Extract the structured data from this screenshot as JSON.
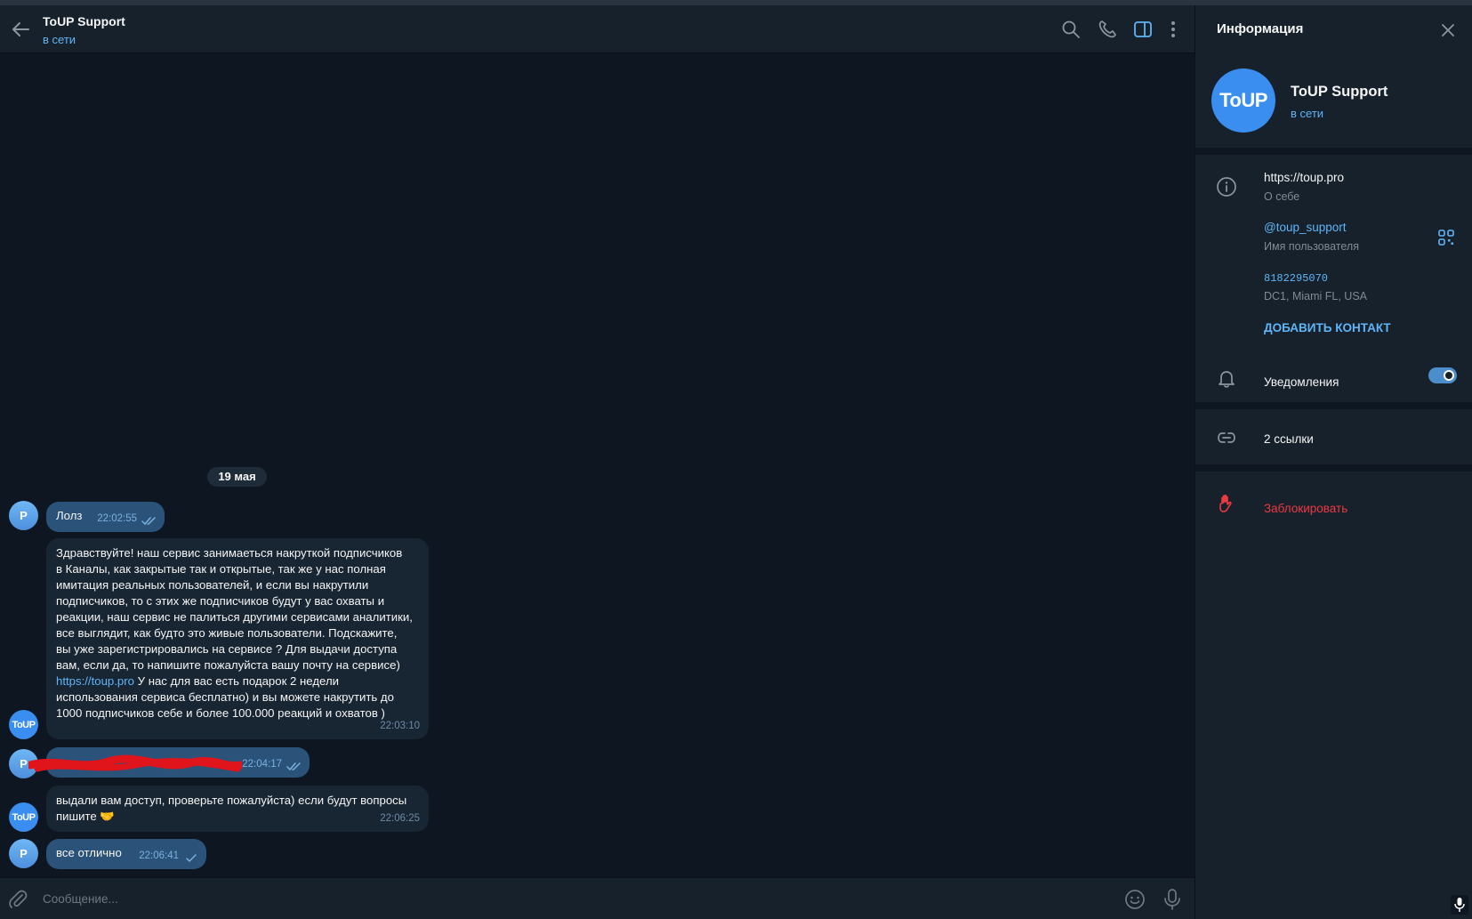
{
  "header": {
    "title": "ToUP Support",
    "status": "в сети"
  },
  "chat": {
    "date": "19 мая",
    "messages": [
      {
        "from": "P",
        "text": "Лолз",
        "time": "22:02:55"
      },
      {
        "from": "ToUP",
        "text_lines": [
          "Здравствуйте! наш сервис занимаеться накруткой подписчиков",
          "в Каналы, как закрытые так и открытые, так же у нас полная",
          "имитация реальных пользователей, и если вы накрутили",
          "подписчиков, то с этих же подписчиков будут у вас охваты и",
          "реакции, наш сервис не палиться другими сервисами аналитики,",
          "все выглядит, как будто это живые пользователи. Подскажите,",
          "вы уже зарегистрировались на сервисе ? Для выдачи доступа",
          "вам, если да, то напишите пожалуйста вашу почту на сервисе)"
        ],
        "link": "https://toup.pro",
        "text_after_link": " У нас для вас есть подарок 2 недели",
        "text_lines_end": [
          "использования сервиса бесплатно) и вы можете накрутить до",
          "1000 подписчиков себе и более 100.000 реакций и охватов )"
        ],
        "time": "22:03:10"
      },
      {
        "from": "P",
        "text": "",
        "time": "22:04:17"
      },
      {
        "from": "ToUP",
        "text_line1": "выдали вам доступ, проверьте пожалуйста) если будут вопросы",
        "text_line2": "пишите 🤝",
        "time": "22:06:25"
      },
      {
        "from": "P",
        "text": "все отлично",
        "time": "22:06:41"
      }
    ],
    "avatar_p": "P",
    "avatar_toup": "ToUP"
  },
  "composer": {
    "placeholder": "Сообщение..."
  },
  "info": {
    "title": "Информация",
    "name": "ToUP Support",
    "status": "в сети",
    "avatar_text": "ToUP",
    "bio": "https://toup.pro",
    "bio_label": "О себе",
    "username": "@toup_support",
    "username_label": "Имя пользователя",
    "user_id": "8182295070",
    "dc": "DC1, Miami FL, USA",
    "add_contact": "ДОБАВИТЬ КОНТАКТ",
    "notifications": "Уведомления",
    "notifications_on": true,
    "links": "2 ссылки",
    "block": "Заблокировать"
  },
  "colors": {
    "accent": "#5eb5f7",
    "danger": "#ec3942",
    "bg": "#0e1621",
    "panel": "#17212b",
    "bubble_in": "#182533",
    "bubble_out": "#2b5278"
  },
  "icons": [
    "back-arrow-icon",
    "search-icon",
    "phone-icon",
    "sidebar-toggle-icon",
    "more-vertical-icon",
    "attach-icon",
    "emoji-icon",
    "mic-icon",
    "close-icon",
    "info-icon",
    "qr-code-icon",
    "bell-icon",
    "link-icon",
    "hand-stop-icon"
  ]
}
